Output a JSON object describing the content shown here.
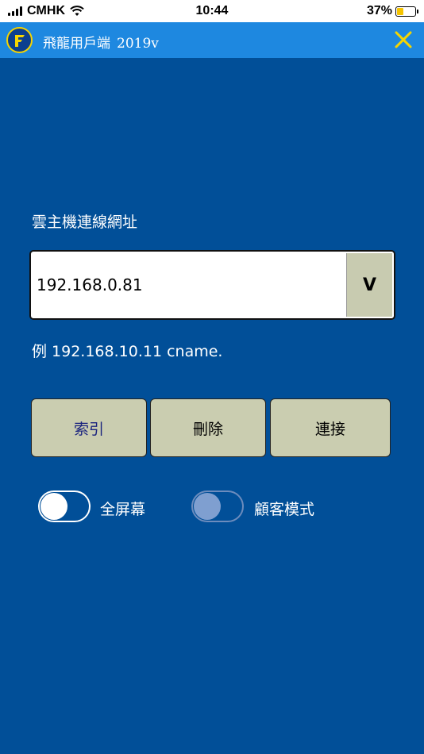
{
  "status_bar": {
    "carrier": "CMHK",
    "time": "10:44",
    "battery": "37%",
    "battery_level": 0.37
  },
  "title_bar": {
    "app_name": "飛龍用戶端",
    "version": "2019v",
    "logo_letter": "F",
    "close_icon": "close-x-icon",
    "accent_color": "#f6d500"
  },
  "form": {
    "url_label": "雲主機連線網址",
    "url_value": "192.168.0.81",
    "dropdown_label": "V",
    "hint": "例 192.168.10.11 cname."
  },
  "buttons": {
    "index": "索引",
    "delete": "刪除",
    "connect": "連接"
  },
  "toggles": {
    "fullscreen_label": "全屏幕",
    "guest_label": "顧客模式"
  },
  "colors": {
    "background": "#014f98",
    "title_bar": "#1e88e0",
    "button": "#cacdb0"
  }
}
